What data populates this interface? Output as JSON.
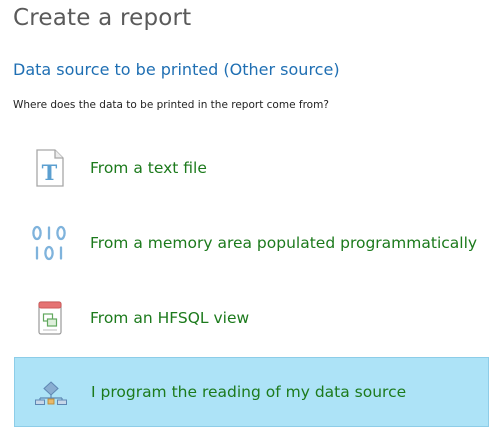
{
  "window": {
    "title": "Create a report"
  },
  "section": {
    "title": "Data source to be printed (Other source)",
    "question": "Where does the data to be printed in the report come from?"
  },
  "options": [
    {
      "label": "From a text file",
      "icon": "text-file-icon",
      "selected": false
    },
    {
      "label": "From a memory area populated programmatically",
      "icon": "binary-memory-icon",
      "selected": false
    },
    {
      "label": "From an HFSQL view",
      "icon": "hfsql-view-icon",
      "selected": false
    },
    {
      "label": "I program the reading of my data source",
      "icon": "program-data-source-icon",
      "selected": true
    }
  ],
  "colors": {
    "title": "#5a5a5a",
    "section_title": "#1f6fb3",
    "option_label": "#1c7a1c",
    "selected_background": "#ade3f7"
  }
}
